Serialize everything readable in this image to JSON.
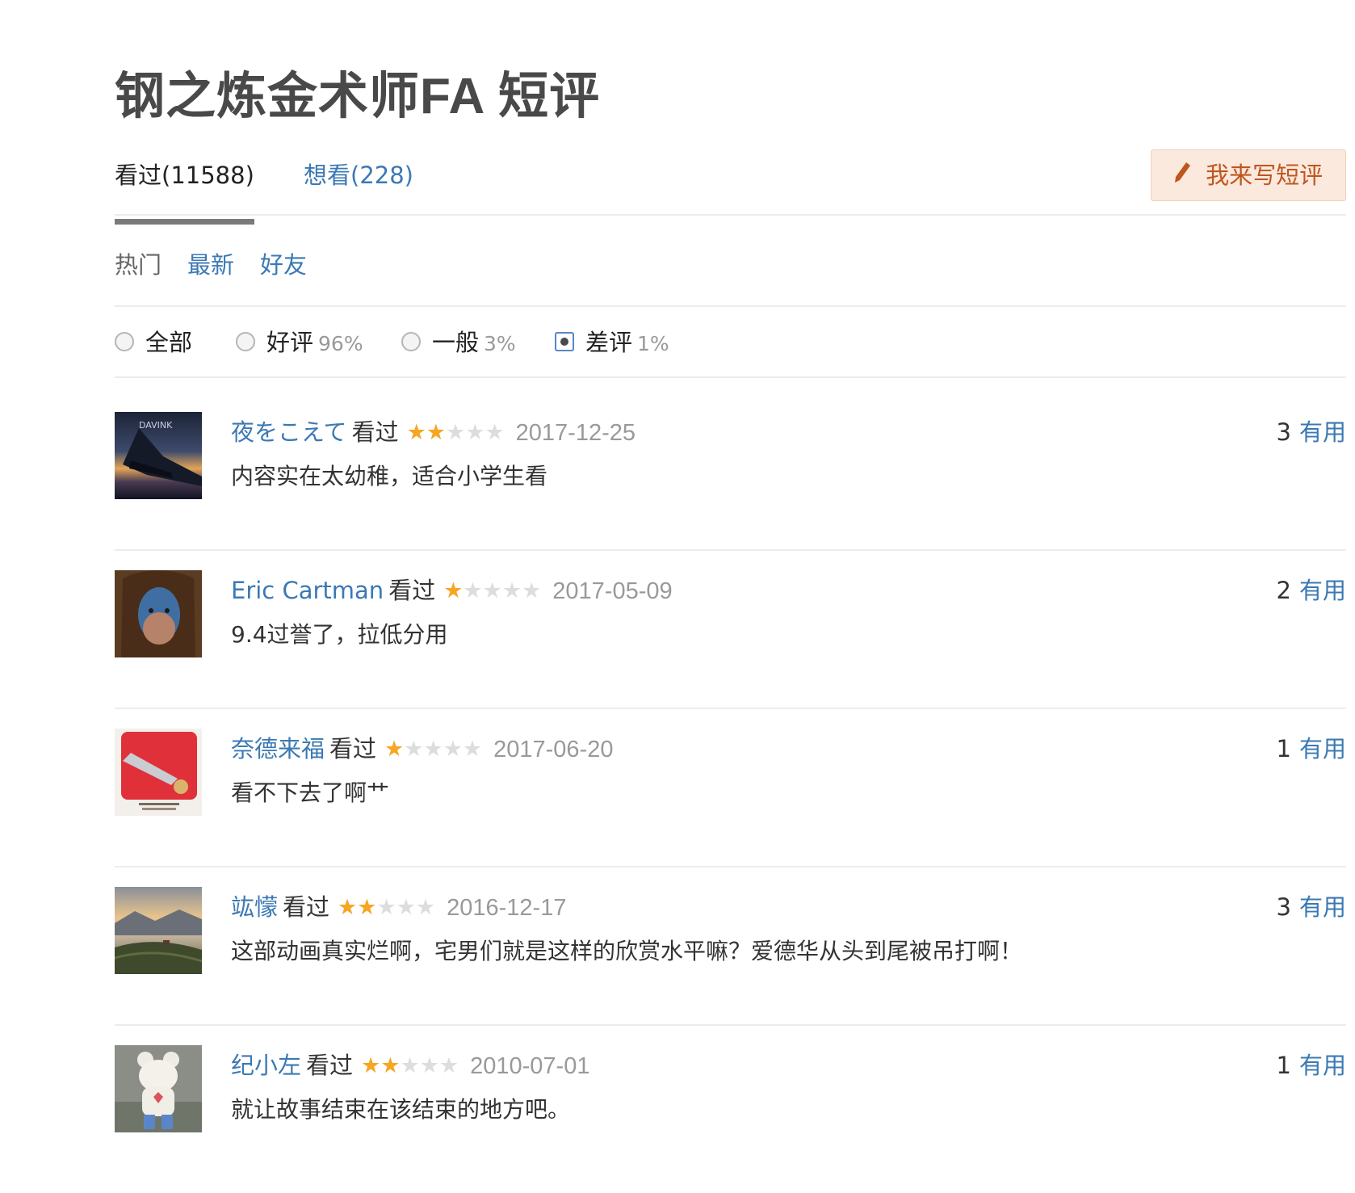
{
  "page_title": "钢之炼金术师FA 短评",
  "tabs": {
    "watched": "看过(11588)",
    "wish": "想看(228)"
  },
  "write_button": {
    "label": "我来写短评",
    "icon": "pencil-icon"
  },
  "sort": {
    "hot": "热门",
    "new": "最新",
    "friends": "好友"
  },
  "filters": {
    "all": {
      "label": "全部"
    },
    "good": {
      "label": "好评",
      "percent": "96%"
    },
    "mid": {
      "label": "一般",
      "percent": "3%"
    },
    "bad": {
      "label": "差评",
      "percent": "1%",
      "selected": true
    }
  },
  "comments": [
    {
      "user": "夜をこえて",
      "status": "看过",
      "rating": 2,
      "date": "2017-12-25",
      "text": "内容实在太幼稚，适合小学生看",
      "votes": "3",
      "useful_label": "有用",
      "avatar": "airplane-wing-avatar"
    },
    {
      "user": "Eric Cartman",
      "status": "看过",
      "rating": 1,
      "date": "2017-05-09",
      "text": "9.4过誉了，拉低分用",
      "votes": "2",
      "useful_label": "有用",
      "avatar": "face-paint-avatar"
    },
    {
      "user": "奈德来福",
      "status": "看过",
      "rating": 1,
      "date": "2017-06-20",
      "text": "看不下去了啊艹",
      "votes": "1",
      "useful_label": "有用",
      "avatar": "red-album-avatar"
    },
    {
      "user": "竑懞",
      "status": "看过",
      "rating": 2,
      "date": "2016-12-17",
      "text": "这部动画真实烂啊，宅男们就是这样的欣赏水平嘛？爱德华从头到尾被吊打啊！",
      "votes": "3",
      "useful_label": "有用",
      "avatar": "landscape-avatar"
    },
    {
      "user": "纪小左",
      "status": "看过",
      "rating": 2,
      "date": "2010-07-01",
      "text": "就让故事结束在该结束的地方吧。",
      "votes": "1",
      "useful_label": "有用",
      "avatar": "bear-figure-avatar"
    }
  ],
  "colors": {
    "link": "#3b79b4",
    "star": "#f6a623",
    "button_bg": "#fbe9dd",
    "button_text": "#c0561f"
  }
}
